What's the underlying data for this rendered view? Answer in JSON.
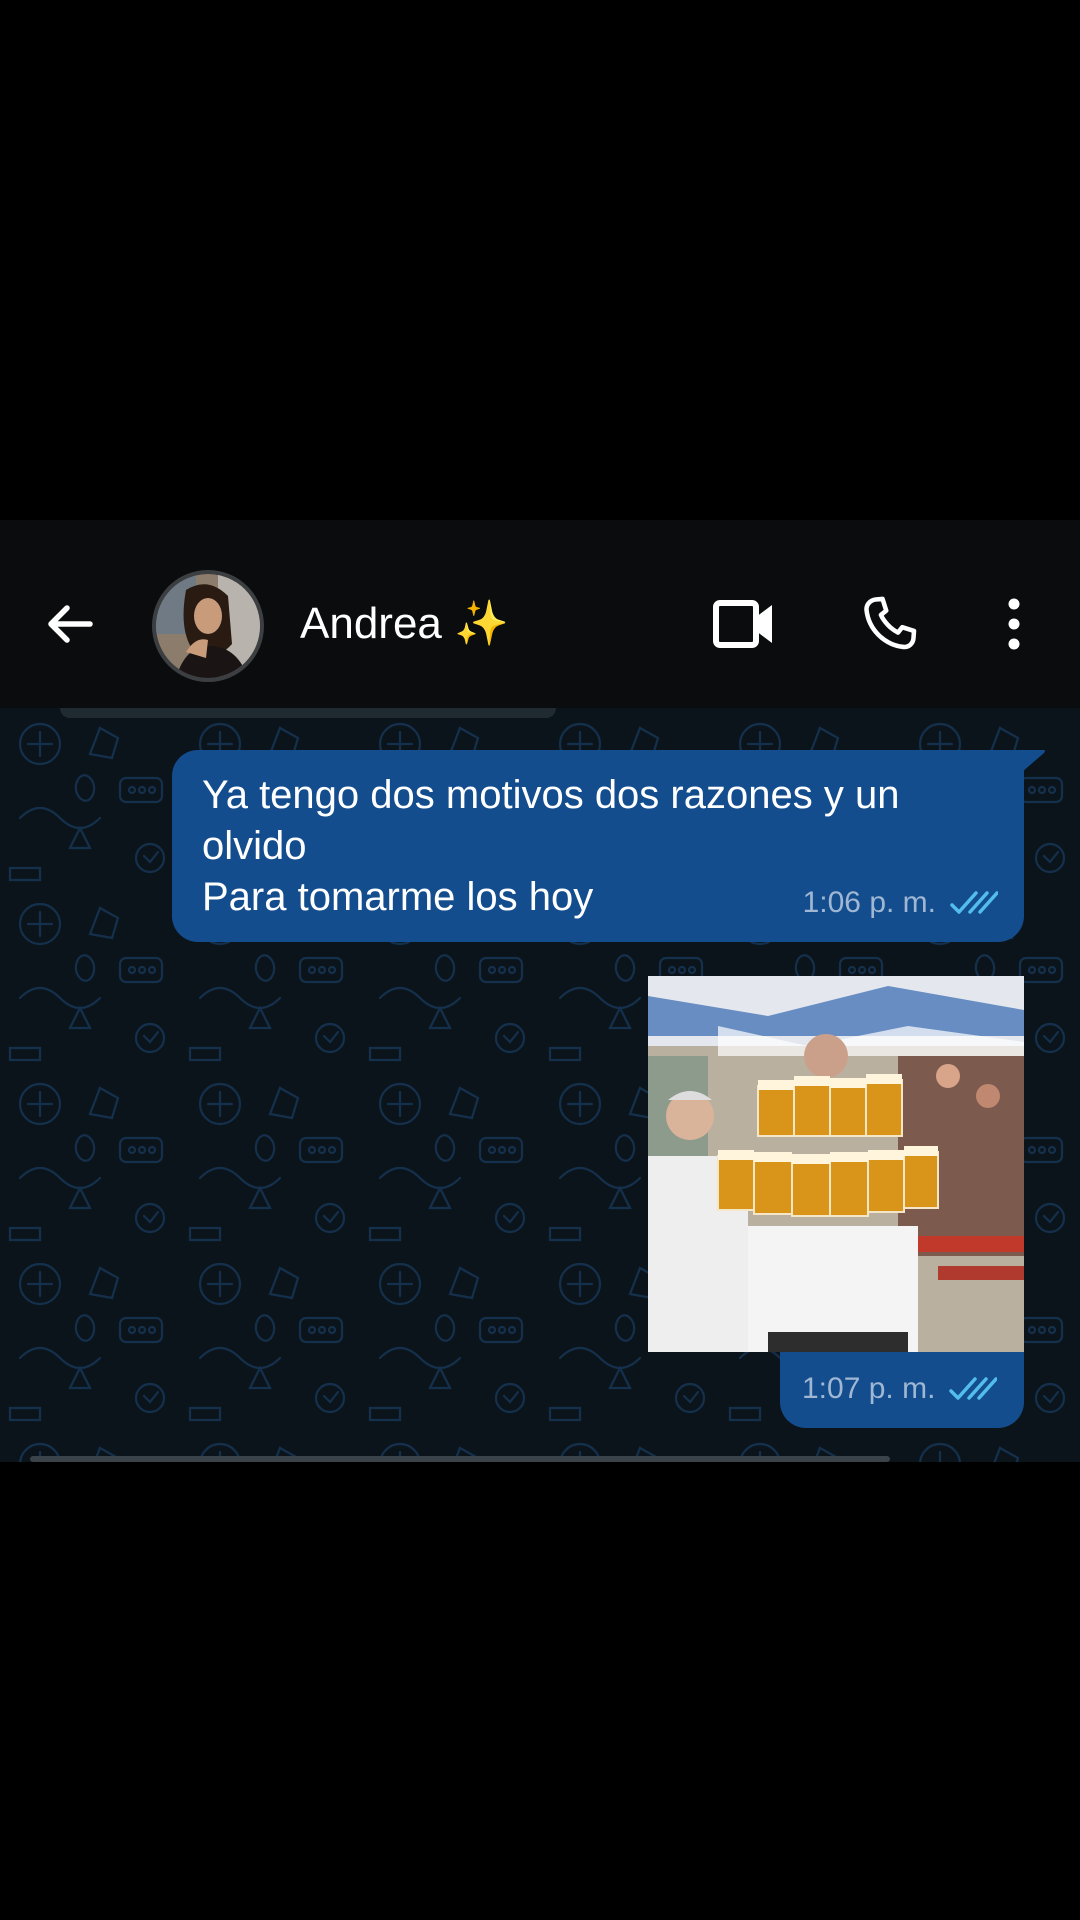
{
  "header": {
    "contact_name": "Andrea ✨"
  },
  "icons": {
    "back": "arrow-left-icon",
    "video": "video-camera-icon",
    "call": "phone-icon",
    "menu": "more-vertical-icon",
    "read_receipt": "double-check-icon"
  },
  "colors": {
    "header_bg": "#0b0c0d",
    "chat_bg": "#0b141a",
    "outgoing_bubble": "#134d8e",
    "read_ticks": "#53bdeb"
  },
  "messages": [
    {
      "lines": [
        "Ya tengo dos motivos dos razones y un",
        "olvido",
        "Para tomarme los hoy"
      ],
      "time": "1:06 p. m."
    },
    {
      "media": "photo",
      "time": "1:07 p. m."
    }
  ]
}
